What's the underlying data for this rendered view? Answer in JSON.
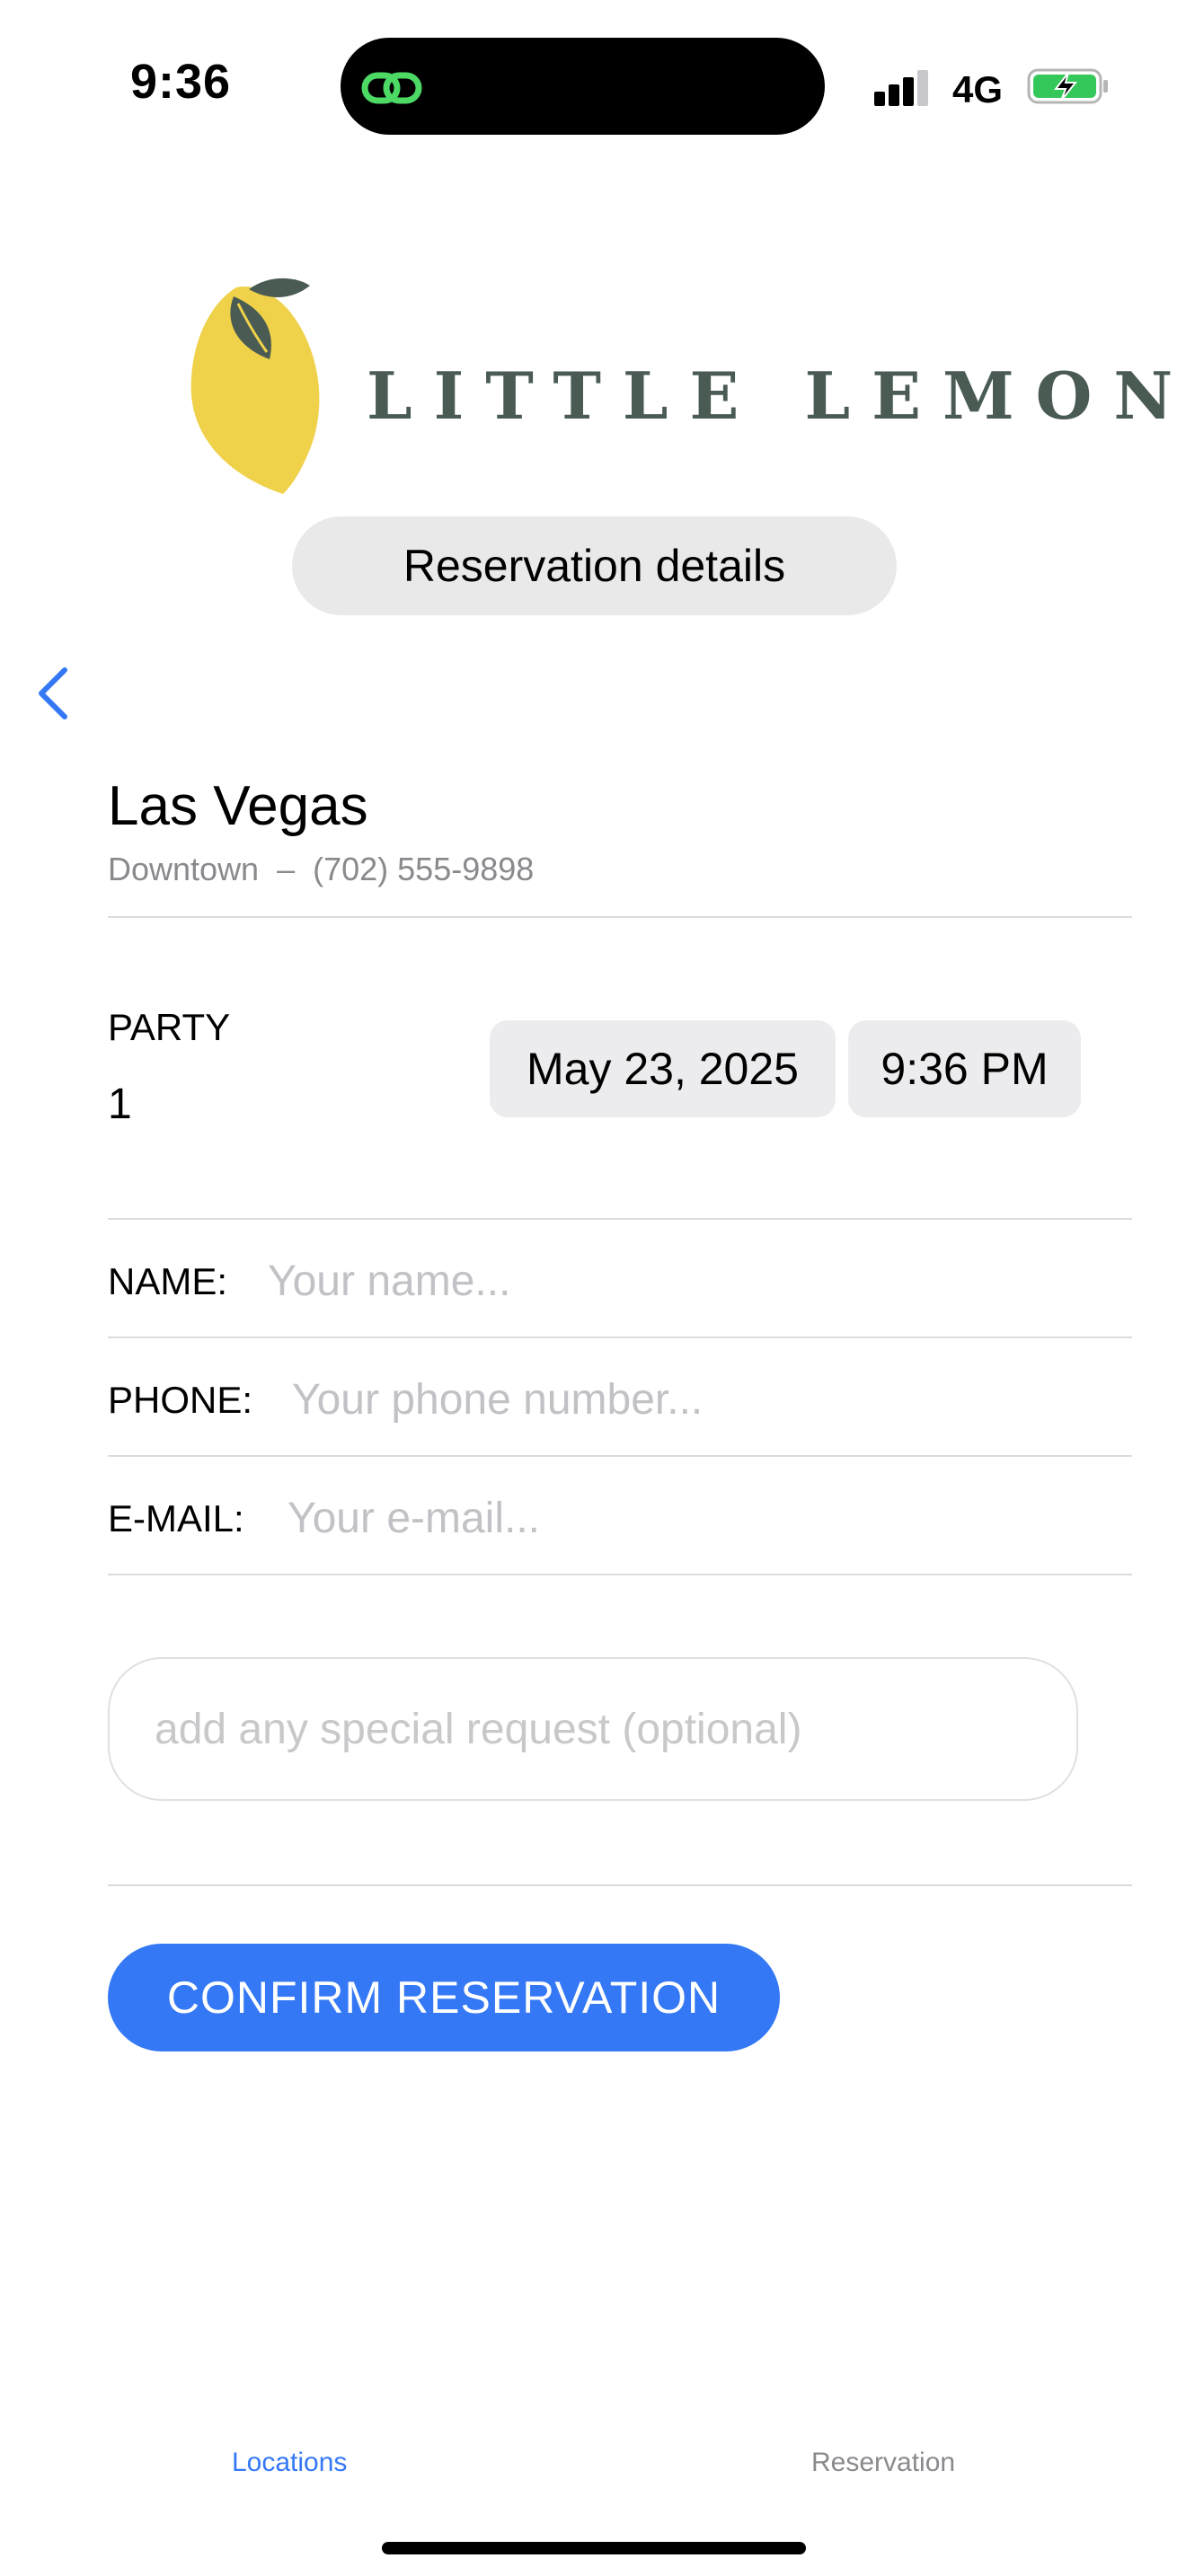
{
  "status_bar": {
    "time": "9:36",
    "network": "4G",
    "icons": [
      "linked-rings-icon",
      "cellular-signal-icon",
      "battery-charging-icon"
    ]
  },
  "brand": {
    "name": "LITTLE LEMON",
    "logo_icon": "lemon-icon",
    "name_color": "#4a5b53"
  },
  "header": {
    "title": "Reservation details",
    "back_icon": "chevron-left-icon"
  },
  "location": {
    "city": "Las Vegas",
    "detail": "Downtown  –  (702) 555-9898"
  },
  "party": {
    "label": "PARTY",
    "value": "1"
  },
  "schedule": {
    "date": "May 23, 2025",
    "time": "9:36 PM"
  },
  "form": {
    "name_label": "NAME:",
    "name_placeholder": "Your name...",
    "name_value": "",
    "phone_label": "PHONE:",
    "phone_placeholder": "Your phone number...",
    "phone_value": "",
    "email_label": "E-MAIL:",
    "email_placeholder": "Your e-mail...",
    "email_value": "",
    "special_placeholder": "add any special request (optional)",
    "special_value": ""
  },
  "actions": {
    "confirm_label": "CONFIRM RESERVATION"
  },
  "tab_bar": {
    "tabs": [
      {
        "label": "Locations",
        "active": true
      },
      {
        "label": "Reservation",
        "active": false
      }
    ]
  },
  "colors": {
    "accent": "#3478f6",
    "pill_bg": "#e9e9ea",
    "placeholder": "#c2c2c6",
    "tab_inactive": "#8a8a8e",
    "battery_fill": "#34c759"
  }
}
